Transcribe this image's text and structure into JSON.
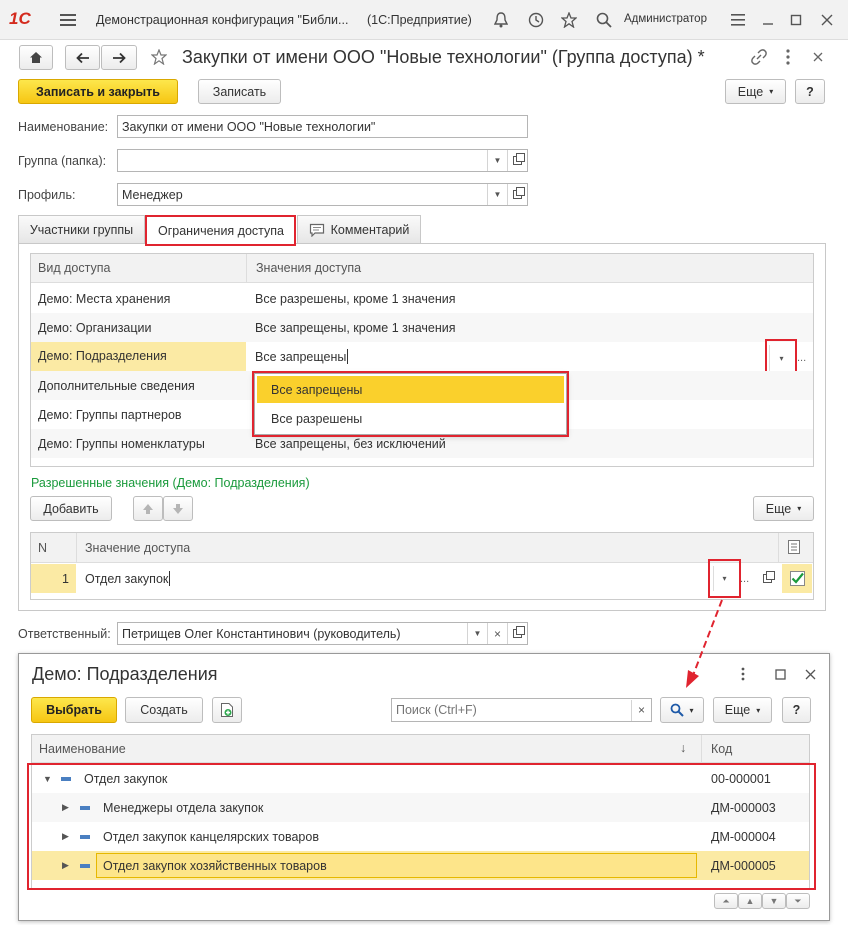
{
  "titlebar": {
    "logo": "1С",
    "title": "Демонстрационная конфигурация \"Библи...",
    "platform": "(1С:Предприятие)",
    "user": "Администратор"
  },
  "doc": {
    "title": "Закупки от имени ООО \"Новые технологии\" (Группа доступа) *"
  },
  "toolbar": {
    "save_close": "Записать и закрыть",
    "save": "Записать",
    "more": "Еще",
    "help": "?"
  },
  "form": {
    "name_label": "Наименование:",
    "name_value": "Закупки от имени ООО \"Новые технологии\"",
    "group_label": "Группа (папка):",
    "group_value": "",
    "profile_label": "Профиль:",
    "profile_value": "Менеджер"
  },
  "tabs": [
    "Участники группы",
    "Ограничения доступа",
    "Комментарий"
  ],
  "access_table": {
    "headers": [
      "Вид доступа",
      "Значения доступа"
    ],
    "rows": [
      {
        "kind": "Демо: Места хранения",
        "value": "Все разрешены, кроме 1 значения"
      },
      {
        "kind": "Демо: Организации",
        "value": "Все запрещены, кроме 1 значения"
      },
      {
        "kind": "Демо: Подразделения",
        "value": "Все запрещены"
      },
      {
        "kind": "Дополнительные сведения",
        "value": ""
      },
      {
        "kind": "Демо: Группы партнеров",
        "value": ""
      },
      {
        "kind": "Демо: Группы номенклатуры",
        "value": "Все запрещены, без исключений"
      }
    ],
    "dropdown_options": [
      "Все запрещены",
      "Все разрешены"
    ],
    "ellipsis": "..."
  },
  "allowed": {
    "title": "Разрешенные значения (Демо: Подразделения)",
    "add": "Добавить",
    "more": "Еще",
    "headers": [
      "N",
      "Значение доступа"
    ],
    "rows": [
      {
        "n": "1",
        "value": "Отдел закупок"
      }
    ],
    "ellipsis": "..."
  },
  "responsible": {
    "label": "Ответственный:",
    "value": "Петрищев Олег Константинович (руководитель)"
  },
  "popup": {
    "title": "Демо: Подразделения",
    "select": "Выбрать",
    "create": "Создать",
    "search_placeholder": "Поиск (Ctrl+F)",
    "more": "Еще",
    "help": "?",
    "headers": [
      "Наименование",
      "Код"
    ],
    "sort_arrow": "↓",
    "rows": [
      {
        "name": "Отдел закупок",
        "code": "00-000001"
      },
      {
        "name": "Менеджеры отдела закупок",
        "code": "ДМ-000003"
      },
      {
        "name": "Отдел закупок канцелярских товаров",
        "code": "ДМ-000004"
      },
      {
        "name": "Отдел закупок хозяйственных товаров",
        "code": "ДМ-000005"
      }
    ]
  },
  "colors": {
    "accent_yellow": "#f6c613",
    "highlight": "#e0242f",
    "green": "#1a9a3c"
  }
}
